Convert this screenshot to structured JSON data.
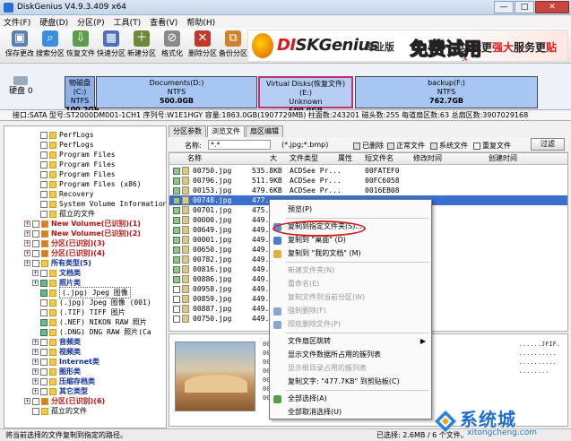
{
  "window": {
    "title": "DiskGenius V4.9.3.409 x64",
    "controls": [
      "—",
      "□",
      "✕"
    ]
  },
  "menu": [
    "文件(F)",
    "硬盘(D)",
    "分区(P)",
    "工具(T)",
    "查看(V)",
    "帮助(H)"
  ],
  "toolbar": [
    {
      "label": "保存更改",
      "icon": "save-icon",
      "color": "#5a7fb5"
    },
    {
      "label": "搜索分区",
      "icon": "search-icon",
      "color": "#3b8ee0"
    },
    {
      "label": "恢复文件",
      "icon": "recover-icon",
      "color": "#5a9e4a"
    },
    {
      "label": "快速分区",
      "icon": "quick-partition-icon",
      "color": "#4a6ec0"
    },
    {
      "label": "新建分区",
      "icon": "new-partition-icon",
      "color": "#6b8b3a"
    },
    {
      "label": "格式化",
      "icon": "format-icon",
      "color": "#8a8a8a"
    },
    {
      "label": "删除分区",
      "icon": "delete-partition-icon",
      "color": "#c0392b"
    },
    {
      "label": "备份分区",
      "icon": "backup-icon",
      "color": "#d2812b"
    }
  ],
  "banner": {
    "brand_a": "DI",
    "brand_b": "SK",
    "brand_c": "Genius",
    "slogan": "专业版",
    "free": "免费试用",
    "promo_a": "功能更",
    "promo_b": "强大",
    "promo_c": "服务更",
    "promo_d": "贴心"
  },
  "disk": {
    "label": "硬盘 0"
  },
  "partitions": [
    {
      "name": "物磁盘(C:)",
      "fs": "NTFS",
      "size": "100.2GB",
      "color": "#8fb0e8"
    },
    {
      "name": "Documents(D:)",
      "fs": "NTFS",
      "size": "500.0GB",
      "color": "#a8c6f2"
    },
    {
      "name": "Virtual Disks(恢复文件)(E:)",
      "fs": "Unknown",
      "size": "500.0GB",
      "color": "#b7cef4"
    },
    {
      "name": "backup(F:)",
      "fs": "NTFS",
      "size": "762.7GB",
      "color": "#a8c6f2"
    }
  ],
  "disk_info": "接口:SATA  型号:ST2000DM001-1CH1  序列号:W1E1HGY  容量:1863.0GB(1907729MB)  柱面数:243201  磁头数:255  每道扇区数:63  总扇区数:3907029168",
  "tree": [
    {
      "t": "PerfLogs",
      "lvl": 4,
      "kind": "file"
    },
    {
      "t": "PerfLogs",
      "lvl": 4,
      "kind": "file"
    },
    {
      "t": "Program Files",
      "lvl": 4,
      "kind": "file"
    },
    {
      "t": "Program Files",
      "lvl": 4,
      "kind": "file"
    },
    {
      "t": "Program Files",
      "lvl": 4,
      "kind": "file"
    },
    {
      "t": "Program Files (x86)",
      "lvl": 4,
      "kind": "file"
    },
    {
      "t": "Recovery",
      "lvl": 4,
      "kind": "file"
    },
    {
      "t": "System Volume Information",
      "lvl": 4,
      "kind": "file"
    },
    {
      "t": "孤立的文件",
      "lvl": 4,
      "kind": "file"
    },
    {
      "t": "New Volume(已识别)(1)",
      "lvl": 2,
      "kind": "red"
    },
    {
      "t": "New Volume(已识别)(2)",
      "lvl": 2,
      "kind": "red"
    },
    {
      "t": "分区(已识别)(3)",
      "lvl": 2,
      "kind": "red"
    },
    {
      "t": "分区(已识别)(4)",
      "lvl": 2,
      "kind": "red"
    },
    {
      "t": "所有类型(5)",
      "lvl": 2,
      "kind": "blue"
    },
    {
      "t": "文档类",
      "lvl": 3,
      "kind": "blue"
    },
    {
      "t": "照片类",
      "lvl": 3,
      "kind": "blue"
    },
    {
      "t": "(.jpg) Jpeg 图像",
      "lvl": 4,
      "kind": "sel"
    },
    {
      "t": "(.jpg) Jpeg 图像 (001)",
      "lvl": 4,
      "kind": "file"
    },
    {
      "t": "(.TIF) TIFF 图片",
      "lvl": 4,
      "kind": "file"
    },
    {
      "t": "(.NEF) NIKON RAW 照片",
      "lvl": 4,
      "kind": "file"
    },
    {
      "t": "(.DNG) DNG RAW 照片(Ca",
      "lvl": 4,
      "kind": "file"
    },
    {
      "t": "音频类",
      "lvl": 3,
      "kind": "blue"
    },
    {
      "t": "视频类",
      "lvl": 3,
      "kind": "blue"
    },
    {
      "t": "Internet类",
      "lvl": 3,
      "kind": "blue"
    },
    {
      "t": "图形类",
      "lvl": 3,
      "kind": "blue"
    },
    {
      "t": "压缩存档类",
      "lvl": 3,
      "kind": "blue"
    },
    {
      "t": "其它类型",
      "lvl": 3,
      "kind": "blue"
    },
    {
      "t": "分区(已识别)(6)",
      "lvl": 2,
      "kind": "red"
    },
    {
      "t": "孤立的文件",
      "lvl": 3,
      "kind": "file"
    }
  ],
  "tabs": [
    "分区参数",
    "浏览文件",
    "扇区编辑"
  ],
  "filter": {
    "name_label": "名称:",
    "name_value": "*.*",
    "ext_hint": "(*.jpg;*.bmp)",
    "deleted": "已删除",
    "normal": "正常文件",
    "system": "系统文件",
    "dup": "重复文件",
    "btn": "过滤"
  },
  "columns": [
    "名称",
    "大",
    "文件类型",
    "属性",
    "短文件名",
    "修改时间",
    "创建时间"
  ],
  "files": [
    {
      "name": "00750.jpg",
      "size": "535.8KB",
      "type": "ACDSee Pr...",
      "short": "00FATEF0"
    },
    {
      "name": "00796.jpg",
      "size": "511.9KB",
      "type": "ACDSee Pr...",
      "short": "00FC6058"
    },
    {
      "name": "00153.jpg",
      "size": "479.6KB",
      "type": "ACDSee Pr...",
      "short": "0016EB08"
    },
    {
      "name": "00748.jpg",
      "size": "477.",
      "type": "",
      "short": ""
    },
    {
      "name": "00701.jpg",
      "size": "475.",
      "type": "",
      "short": ""
    },
    {
      "name": "00000.jpg",
      "size": "449.",
      "type": "",
      "short": ""
    },
    {
      "name": "00649.jpg",
      "size": "449.",
      "type": "",
      "short": ""
    },
    {
      "name": "00001.jpg",
      "size": "449.",
      "type": "",
      "short": ""
    },
    {
      "name": "00650.jpg",
      "size": "449.",
      "type": "",
      "short": ""
    },
    {
      "name": "00782.jpg",
      "size": "449.",
      "type": "",
      "short": ""
    },
    {
      "name": "00816.jpg",
      "size": "449.",
      "type": "",
      "short": ""
    },
    {
      "name": "00886.jpg",
      "size": "449.",
      "type": "",
      "short": ""
    },
    {
      "name": "00958.jpg",
      "size": "449.",
      "type": "",
      "short": ""
    },
    {
      "name": "00859.jpg",
      "size": "449.",
      "type": "",
      "short": ""
    },
    {
      "name": "00887.jpg",
      "size": "449.",
      "type": "",
      "short": ""
    },
    {
      "name": "00750.jpg",
      "size": "449.",
      "type": "",
      "short": ""
    }
  ],
  "context_menu": [
    {
      "label": "预览(P)",
      "disabled": false,
      "icon": ""
    },
    {
      "label": "复制到指定文件夹(S)...",
      "disabled": false,
      "icon": "#5b8ed8"
    },
    {
      "label": "复制到 \"桌面\" (D)",
      "disabled": false,
      "icon": "#4a7ccc"
    },
    {
      "label": "复制到 \"我的文档\" (M)",
      "disabled": false,
      "icon": "#e0b040"
    },
    {
      "label": "新建文件夹(N)",
      "disabled": true,
      "icon": ""
    },
    {
      "label": "重命名(E)",
      "disabled": true,
      "icon": ""
    },
    {
      "label": "复制文件到当前分区(W)",
      "disabled": true,
      "icon": ""
    },
    {
      "label": "强制删除(F)",
      "disabled": true,
      "icon": "#8aa6d0"
    },
    {
      "label": "彻底删除文件(P)",
      "disabled": true,
      "icon": "#8aa6d0"
    },
    {
      "label": "文件扇区跳转",
      "disabled": false,
      "icon": "",
      "arrow": "▶"
    },
    {
      "label": "显示文件数据所占用的簇列表",
      "disabled": false,
      "icon": ""
    },
    {
      "label": "显示根目录占用的簇列表",
      "disabled": true,
      "icon": ""
    },
    {
      "label": "复制文字: \"477.7KB\" 到剪贴板(C)",
      "disabled": false,
      "icon": ""
    },
    {
      "label": "全部选择(A)",
      "disabled": false,
      "icon": "#5a9e4a"
    },
    {
      "label": "全部取消选择(U)",
      "disabled": false,
      "icon": ""
    }
  ],
  "preview": {
    "hex_lines": [
      "00",
      "00",
      "00",
      "00",
      "00",
      "00",
      "00"
    ],
    "ascii_lines": [
      "......JFIF.",
      "..........",
      "..........",
      "........"
    ]
  },
  "status": {
    "left": "将当前选择的文件复制到指定的路径。",
    "right": "已选择: 2.6MB / 6 个文件。"
  },
  "watermark": {
    "title": "系统城",
    "url": "xitongcheng.com"
  }
}
